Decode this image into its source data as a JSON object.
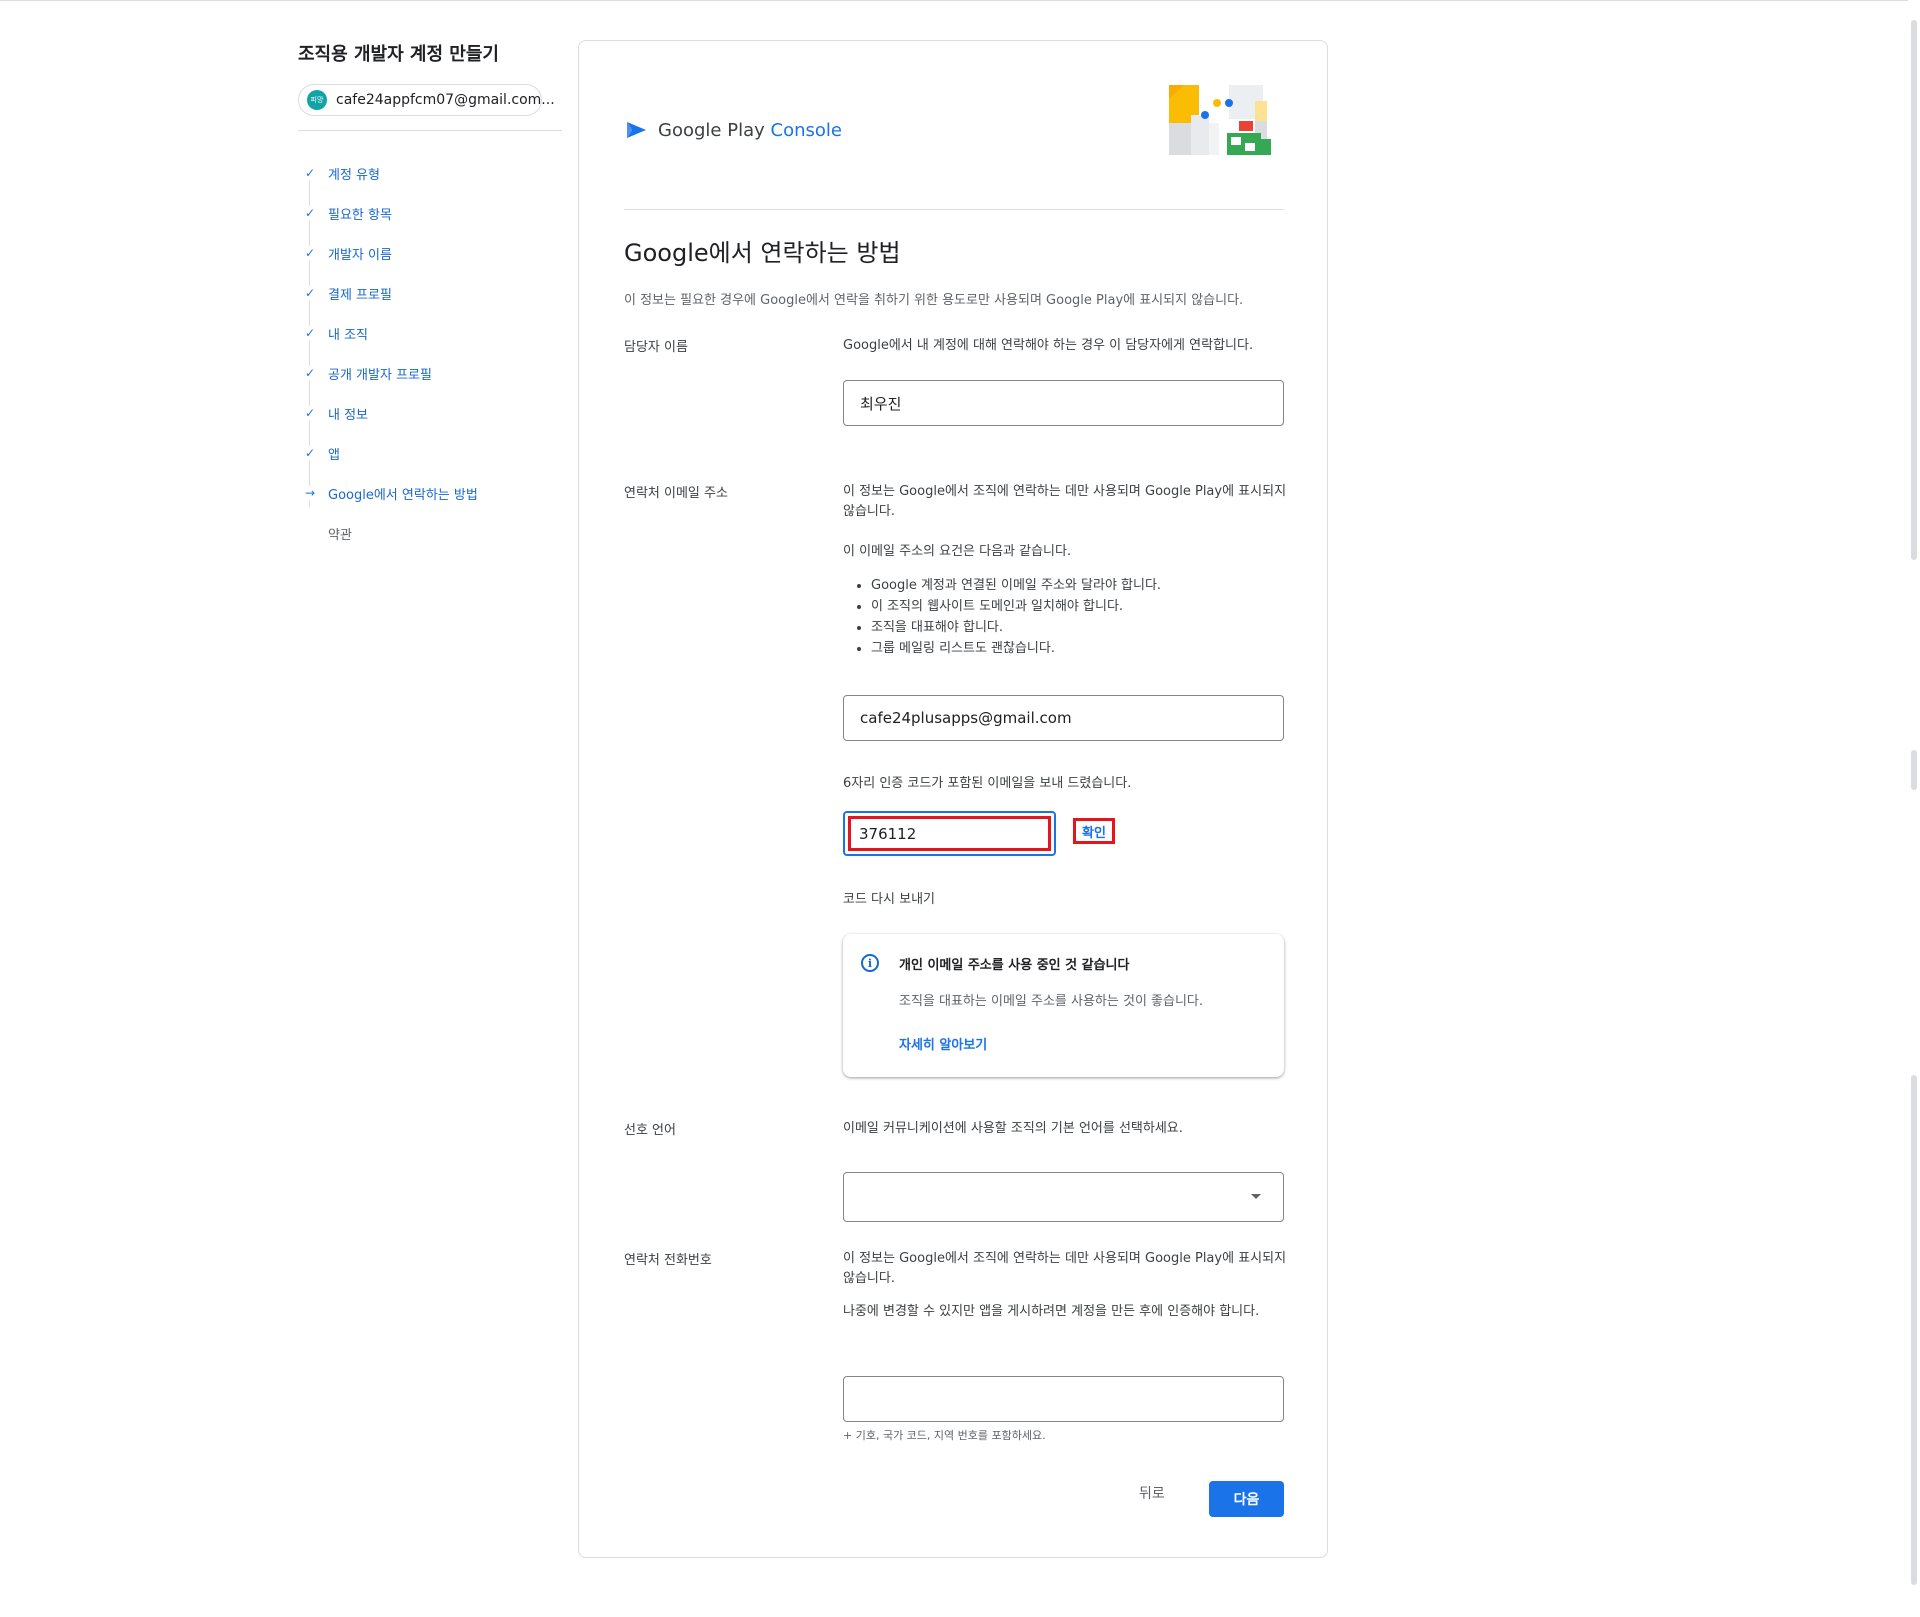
{
  "sidebar": {
    "title": "조직용 개발자 계정 만들기",
    "account": {
      "avatar_text": "피망",
      "email": "cafe24appfcm07@gmail.com..."
    },
    "steps": [
      {
        "label": "계정 유형",
        "mark": "✓"
      },
      {
        "label": "필요한 항목",
        "mark": "✓"
      },
      {
        "label": "개발자 이름",
        "mark": "✓"
      },
      {
        "label": "결제 프로필",
        "mark": "✓"
      },
      {
        "label": "내 조직",
        "mark": "✓"
      },
      {
        "label": "공개 개발자 프로필",
        "mark": "✓"
      },
      {
        "label": "내 정보",
        "mark": "✓"
      },
      {
        "label": "앱",
        "mark": "✓"
      },
      {
        "label": "Google에서 연락하는 방법",
        "mark": "→"
      },
      {
        "label": "약관",
        "mark": ""
      }
    ]
  },
  "header": {
    "logo_google": "Google",
    "logo_play": "Play",
    "logo_console": "Console"
  },
  "main": {
    "title": "Google에서 연락하는 방법",
    "description": "이 정보는 필요한 경우에 Google에서 연락을 취하기 위한 용도로만 사용되며 Google Play에 표시되지 않습니다.",
    "contact_name": {
      "label": "담당자 이름",
      "help": "Google에서 내 계정에 대해 연락해야 하는 경우 이 담당자에게 연락합니다.",
      "value": "최우진"
    },
    "contact_email": {
      "label": "연락처 이메일 주소",
      "help": "이 정보는 Google에서 조직에 연락하는 데만 사용되며 Google Play에 표시되지 않습니다.",
      "requirements_intro": "이 이메일 주소의 요건은 다음과 같습니다.",
      "requirements": [
        "Google 계정과 연결된 이메일 주소와 달라야 합니다.",
        "이 조직의 웹사이트 도메인과 일치해야 합니다.",
        "조직을 대표해야 합니다.",
        "그룹 메일링 리스트도 괜찮습니다."
      ],
      "value": "cafe24plusapps@gmail.com",
      "code_sent": "6자리 인증 코드가 포함된 이메일을 보내 드렸습니다.",
      "code_value": "376112",
      "confirm_label": "확인",
      "resend_label": "코드 다시 보내기"
    },
    "notice": {
      "title": "개인 이메일 주소를 사용 중인 것 같습니다",
      "body": "조직을 대표하는 이메일 주소를 사용하는 것이 좋습니다.",
      "link": "자세히 알아보기"
    },
    "language": {
      "label": "선호 언어",
      "help": "이메일 커뮤니케이션에 사용할 조직의 기본 언어를 선택하세요.",
      "value": ""
    },
    "phone": {
      "label": "연락처 전화번호",
      "help": "이 정보는 Google에서 조직에 연락하는 데만 사용되며 Google Play에 표시되지 않습니다.",
      "help2": "나중에 변경할 수 있지만 앱을 게시하려면 계정을 만든 후에 인증해야 합니다.",
      "value": "",
      "hint": "+ 기호, 국가 코드, 지역 번호를 포함하세요."
    },
    "actions": {
      "back": "뒤로",
      "next": "다음"
    }
  },
  "colors": {
    "accent": "#1a73e8",
    "highlight": "#e4151c"
  }
}
